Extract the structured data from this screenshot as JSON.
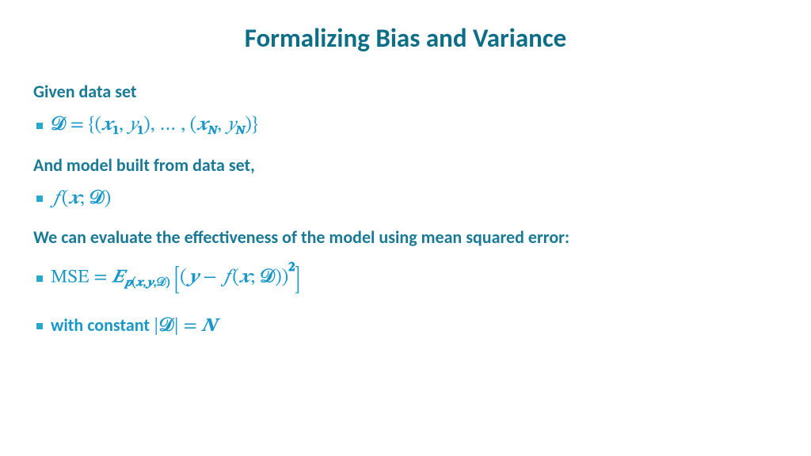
{
  "title": "Formalizing Bias and Variance",
  "h1": "Given data set",
  "h2": "And model built from data set,",
  "h3": "We can evaluate the effectiveness of the model using mean squared error:",
  "sym": {
    "D": "𝒟",
    "eq": " = ",
    "lb": "{",
    "rb": "}",
    "lp": "(",
    "rp": ")",
    "x": "𝒙",
    "y": "𝑦",
    "bold_y": "𝒚",
    "one": "𝟏",
    "N": "𝑵",
    "comma": ", ",
    "dots": "… ",
    "semi": "; ",
    "f": "𝑓",
    "MSE": "MSE",
    "E": "𝑬",
    "p": "𝒑",
    "minus": " − ",
    "two": "𝟐",
    "abs": "|",
    "Nplain": "𝑵"
  },
  "label_with": "with constant "
}
